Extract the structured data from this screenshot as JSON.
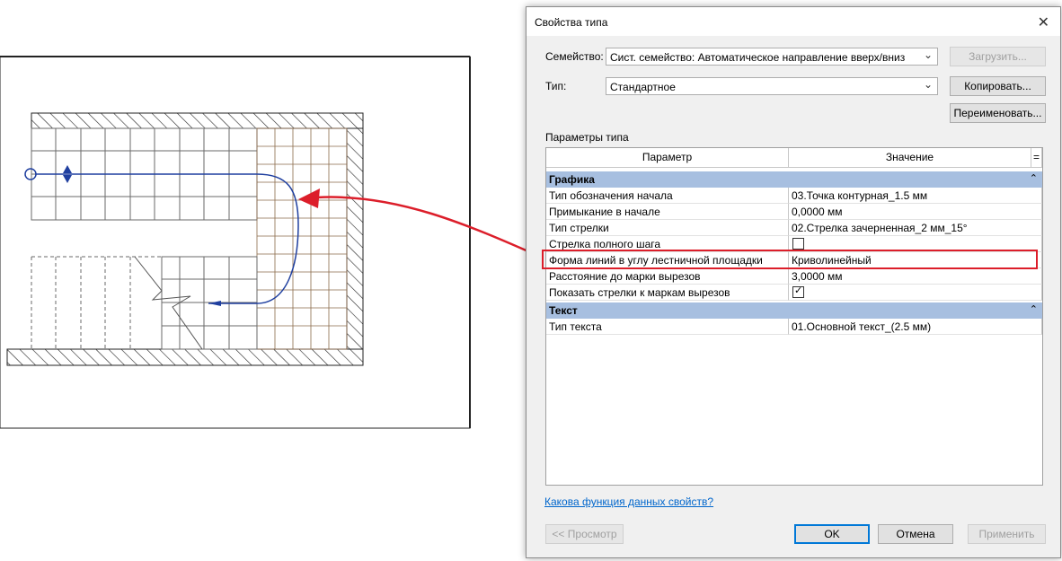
{
  "dialog": {
    "title": "Свойства типа",
    "family_label": "Семейство:",
    "family_value": "Сист. семейство: Автоматическое направление вверх/вниз",
    "type_label": "Тип:",
    "type_value": "Стандартное",
    "load_button": "Загрузить...",
    "copy_button": "Копировать...",
    "rename_button": "Переименовать...",
    "params_label": "Параметры типа",
    "col_param": "Параметр",
    "col_value": "Значение",
    "col_eq": "=",
    "groups": [
      {
        "name": "Графика",
        "rows": [
          {
            "param": "Тип обозначения начала",
            "value": "03.Точка контурная_1.5 мм"
          },
          {
            "param": "Примыкание в начале",
            "value": "0,0000 мм"
          },
          {
            "param": "Тип стрелки",
            "value": "02.Стрелка зачерненная_2 мм_15°"
          },
          {
            "param": "Стрелка полного шага",
            "value": ""
          },
          {
            "param": "Форма линий в углу лестничной площадки",
            "value": "Криволинейный"
          },
          {
            "param": "Расстояние до марки вырезов",
            "value": "3,0000 мм"
          },
          {
            "param": "Показать стрелки к маркам вырезов",
            "value": ""
          }
        ]
      },
      {
        "name": "Текст",
        "rows": [
          {
            "param": "Тип текста",
            "value": "01.Основной текст_(2.5 мм)"
          }
        ]
      }
    ],
    "help_link": "Какова функция данных свойств?",
    "preview_button": "<< Просмотр",
    "ok_button": "OK",
    "cancel_button": "Отмена",
    "apply_button": "Применить"
  },
  "colors": {
    "highlight": "#dc1e2a",
    "group_bg": "#a7bfe0",
    "path_line": "#1f3f9f",
    "grid_line": "#8a6a4a"
  }
}
